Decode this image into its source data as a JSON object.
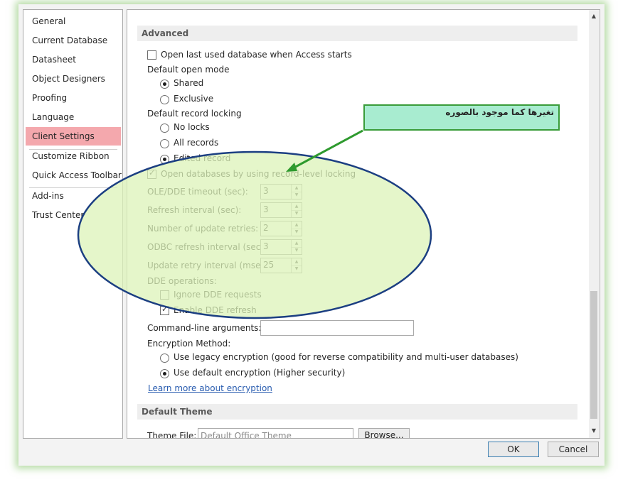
{
  "sidebar": {
    "items": [
      {
        "label": "General"
      },
      {
        "label": "Current Database"
      },
      {
        "label": "Datasheet"
      },
      {
        "label": "Object Designers"
      },
      {
        "label": "Proofing"
      },
      {
        "label": "Language"
      },
      {
        "label": "Client Settings",
        "selected": true
      },
      {
        "label": "Customize Ribbon"
      },
      {
        "label": "Quick Access Toolbar"
      },
      {
        "label": "Add-ins"
      },
      {
        "label": "Trust Center"
      }
    ]
  },
  "advanced": {
    "header": "Advanced",
    "open_last_used": {
      "label": "Open last used database when Access starts",
      "checked": false
    },
    "default_open_mode": {
      "label": "Default open mode",
      "options": [
        {
          "label": "Shared",
          "selected": true
        },
        {
          "label": "Exclusive",
          "selected": false
        }
      ]
    },
    "default_record_locking": {
      "label": "Default record locking",
      "options": [
        {
          "label": "No locks",
          "selected": false
        },
        {
          "label": "All records",
          "selected": false
        },
        {
          "label": "Edited record",
          "selected": true
        }
      ]
    },
    "record_level_locking": {
      "label": "Open databases by using record-level locking",
      "checked": true
    },
    "spinners": [
      {
        "label": "OLE/DDE timeout (sec):",
        "value": "3"
      },
      {
        "label": "Refresh interval (sec):",
        "value": "3"
      },
      {
        "label": "Number of update retries:",
        "value": "2"
      },
      {
        "label": "ODBC refresh interval (sec):",
        "value": "3"
      },
      {
        "label": "Update retry interval (msec):",
        "value": "25"
      }
    ],
    "dde_operations": {
      "label": "DDE operations:",
      "ignore": {
        "label": "Ignore DDE requests",
        "checked": false
      },
      "enable_refresh": {
        "label": "Enable DDE refresh",
        "checked": true
      }
    },
    "command_line": {
      "label": "Command-line arguments:",
      "value": ""
    },
    "encryption": {
      "label": "Encryption Method:",
      "options": [
        {
          "label": "Use legacy encryption (good for reverse compatibility and multi-user databases)",
          "selected": false
        },
        {
          "label": "Use default encryption (Higher security)",
          "selected": true
        }
      ],
      "learn_more": "Learn more about encryption"
    }
  },
  "default_theme": {
    "header": "Default Theme",
    "theme_file_label": "Theme File:",
    "theme_file_placeholder": "Default Office Theme",
    "browse_label": "Browse..."
  },
  "footer": {
    "ok_label": "OK",
    "cancel_label": "Cancel"
  },
  "annotation": {
    "callout_text": "تغيرها كما موجود بالصوره",
    "colors": {
      "ellipse_fill": "#dcf3b8",
      "ellipse_stroke": "#1c3f82",
      "callout_fill": "#a8ecd0",
      "arrow": "#2e9a2e"
    }
  },
  "colors": {
    "selected_nav": "#f4a8ad",
    "link": "#2a5db0",
    "dialog_glow": "#78be5a"
  }
}
